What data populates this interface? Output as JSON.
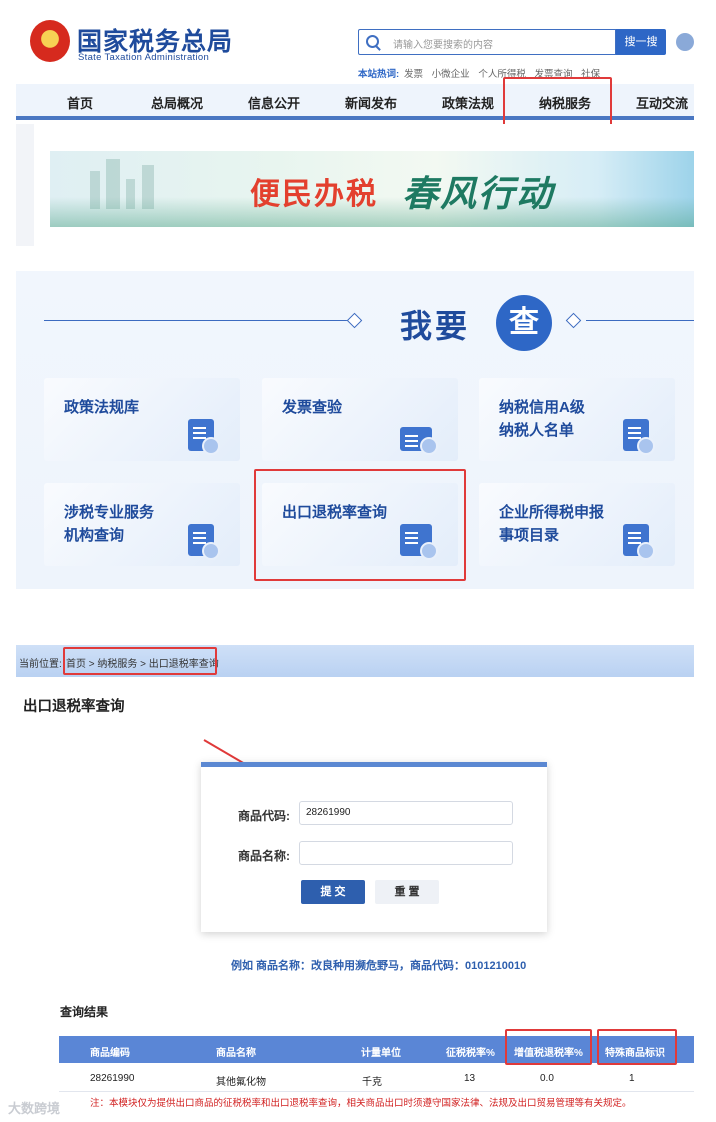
{
  "header": {
    "logo_cn": "国家税务总局",
    "logo_en": "State Taxation Administration",
    "search_placeholder": "请输入您要搜索的内容",
    "search_button": "搜一搜",
    "hot_label": "本站热词:",
    "hot_words": [
      "发票",
      "小微企业",
      "个人所得税",
      "发票查询",
      "社保"
    ]
  },
  "nav": {
    "items": [
      "首页",
      "总局概况",
      "信息公开",
      "新闻发布",
      "政策法规",
      "纳税服务",
      "互动交流"
    ],
    "highlighted": "纳税服务"
  },
  "banner": {
    "text_1": "便民办税",
    "text_2": "春风行动"
  },
  "query_section": {
    "title": "我要",
    "circle_char": "查",
    "cards": [
      {
        "label_1": "政策法规库",
        "label_2": ""
      },
      {
        "label_1": "发票查验",
        "label_2": ""
      },
      {
        "label_1": "纳税信用A级",
        "label_2": "纳税人名单"
      },
      {
        "label_1": "涉税专业服务",
        "label_2": "机构查询"
      },
      {
        "label_1": "出口退税率查询",
        "label_2": ""
      },
      {
        "label_1": "企业所得税申报",
        "label_2": "事项目录"
      }
    ],
    "highlighted_card": "出口退税率查询"
  },
  "breadcrumb": {
    "label": "当前位置:",
    "path": "首页 > 纳税服务 > 出口退税率查询"
  },
  "page_title": "出口退税率查询",
  "form": {
    "code_label": "商品代码:",
    "code_value": "28261990",
    "name_label": "商品名称:",
    "name_value": "",
    "submit": "提 交",
    "reset": "重 置"
  },
  "example_text": "例如 商品名称：改良种用濒危野马，商品代码：0101210010",
  "results": {
    "title": "查询结果",
    "headers": [
      "商品编码",
      "商品名称",
      "计量单位",
      "征税税率%",
      "增值税退税率%",
      "特殊商品标识"
    ],
    "rows": [
      [
        "28261990",
        "其他氟化物",
        "千克",
        "13",
        "0.0",
        "1"
      ]
    ],
    "note": "注：本模块仅为提供出口商品的征税税率和出口退税率查询，相关商品出口时须遵守国家法律、法规及出口贸易管理等有关规定。"
  },
  "watermark": "大数跨境",
  "colors": {
    "brand_blue": "#1f4b9c",
    "accent_blue": "#2e67c6",
    "highlight_red": "#e03a3a"
  }
}
